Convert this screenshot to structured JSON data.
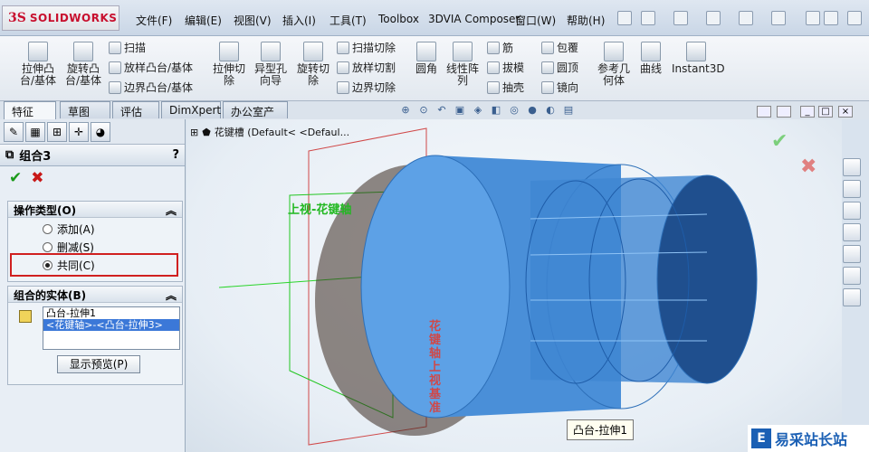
{
  "app": {
    "logo_prefix": "3S",
    "logo_name": "SOLIDWORKS"
  },
  "menus": [
    "文件(F)",
    "编辑(E)",
    "视图(V)",
    "插入(I)",
    "工具(T)",
    "Toolbox",
    "3DVIA Composer",
    "窗口(W)",
    "帮助(H)"
  ],
  "ribbon": {
    "extrude_boss": "拉伸凸台/基体",
    "revolve_boss": "旋转凸台/基体",
    "sweep": "扫描",
    "loft": "放样凸台/基体",
    "boundary": "边界凸台/基体",
    "extrude_cut": "拉伸切除",
    "hole_wizard": "异型孔向导",
    "revolve_cut": "旋转切除",
    "sweep_cut": "扫描切除",
    "loft_cut": "放样切割",
    "boundary_cut": "边界切除",
    "fillet": "圆角",
    "pattern": "线性阵列",
    "rib": "筋",
    "draft": "拔模",
    "shell": "抽壳",
    "wrap": "包覆",
    "dome": "圆顶",
    "mirror": "镜向",
    "ref_geom": "参考几何体",
    "curves": "曲线",
    "instant3d": "Instant3D"
  },
  "tabs": [
    "特征",
    "草图",
    "评估",
    "DimXpert",
    "办公室产品"
  ],
  "panel": {
    "title": "组合3",
    "help": "?",
    "op_group": "操作类型(O)",
    "options": [
      {
        "label": "添加(A)",
        "selected": false
      },
      {
        "label": "删减(S)",
        "selected": false
      },
      {
        "label": "共同(C)",
        "selected": true
      }
    ],
    "bodies_group": "组合的实体(B)",
    "bodies": [
      {
        "text": "凸台-拉伸1",
        "selected": false
      },
      {
        "text": "<花键轴>-<凸台-拉伸3>",
        "selected": true
      }
    ],
    "preview_button": "显示预览(P)"
  },
  "tree": {
    "text": "花键槽  (Default< <Defaul..."
  },
  "viewport": {
    "plane_label": "上视-花键轴",
    "vertical_label": "花键轴\n上视基准"
  },
  "tooltip": "凸台-拉伸1",
  "watermark": {
    "text": "易采站长站"
  }
}
